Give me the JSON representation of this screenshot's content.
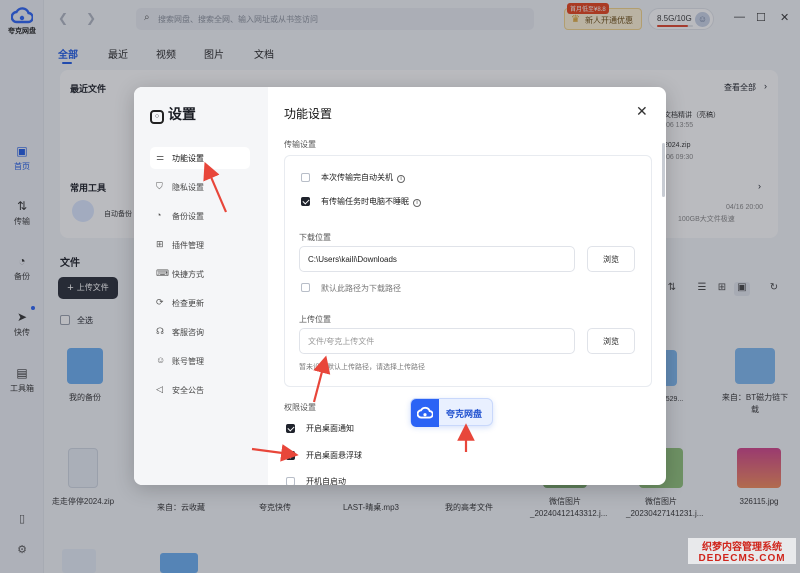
{
  "app": {
    "logo_label": "夸克网盘",
    "brand_color": "#2b63f5"
  },
  "rail": {
    "items": [
      {
        "label": "首页",
        "icon": "home-icon"
      },
      {
        "label": "传输",
        "icon": "transfer-icon"
      },
      {
        "label": "备份",
        "icon": "backup-icon"
      },
      {
        "label": "快传",
        "icon": "send-icon"
      },
      {
        "label": "工具箱",
        "icon": "toolbox-icon"
      }
    ]
  },
  "topbar": {
    "search_placeholder": "搜索网盘、搜索全网、输入网址或从书签访问",
    "promo_badge": "首月低至¥8.8",
    "promo_text": "新人开通优惠",
    "storage": "8.5G/10G",
    "storage_used_fraction": 0.85
  },
  "tabs": [
    "全部",
    "最近",
    "视频",
    "图片",
    "文档"
  ],
  "background": {
    "recent_title": "最近文件",
    "view_all": "查看全部",
    "common_tools": "常用工具",
    "auto_backup": "自动备份",
    "recent_right_1": "文档精讲（亮稿）",
    "recent_right_1_date": "/06 13:55",
    "recent_right_2": "2024.zip",
    "recent_right_2_date": "/06 09:30",
    "recent_right_3_date": "04/16 20:00",
    "recent_right_3_sub": "100GB大文件极速",
    "files_title": "文件",
    "upload_label": "上传文件",
    "select_all": "全选",
    "tiles": [
      {
        "name": "我的备份"
      },
      {
        "name": "来自：BT磁力链下载"
      },
      {
        "name": "走走停停2024.zip"
      },
      {
        "name": "来自：云收藏"
      },
      {
        "name": "夸克快传"
      },
      {
        "name": "LAST-晴桌.mp3"
      },
      {
        "name": "我的高考文件"
      },
      {
        "name": "微信图片_20240412143312.j..."
      },
      {
        "name": "微信图片_20230427141231.j..."
      },
      {
        "name": "326115.jpg"
      },
      {
        "name": "来-24 4529..."
      }
    ]
  },
  "dialog": {
    "title": "设置",
    "nav": [
      {
        "label": "功能设置",
        "icon": "sliders-icon",
        "active": true
      },
      {
        "label": "隐私设置",
        "icon": "shield-icon",
        "active": false
      },
      {
        "label": "备份设置",
        "icon": "backup-icon",
        "active": false
      },
      {
        "label": "插件管理",
        "icon": "plugin-icon",
        "active": false
      },
      {
        "label": "快捷方式",
        "icon": "shortcut-icon",
        "active": false
      },
      {
        "label": "检查更新",
        "icon": "update-icon",
        "active": false
      },
      {
        "label": "客服咨询",
        "icon": "headset-icon",
        "active": false
      },
      {
        "label": "账号管理",
        "icon": "account-icon",
        "active": false
      },
      {
        "label": "安全公告",
        "icon": "announce-icon",
        "active": false
      }
    ],
    "heading": "功能设置",
    "transfer_section": "传输设置",
    "opt_shutdown": "本次传输完自动关机",
    "opt_no_sleep": "有传输任务时电脑不睡眠",
    "download_label": "下载位置",
    "download_path": "C:\\Users\\kaili\\Downloads",
    "browse": "浏览",
    "download_default": "默认此路径为下载路径",
    "upload_label": "上传位置",
    "upload_placeholder": "文件/夸克上传文件",
    "upload_hint": "暂未设置默认上传路径，请选择上传路径",
    "permission_section": "权限设置",
    "opt_desktop_notify": "开启桌面通知",
    "opt_floating_ball": "开启桌面悬浮球",
    "opt_autostart": "开机自启动"
  },
  "floating_ball": {
    "label": "夸克网盘"
  },
  "watermark": {
    "line1": "织梦内容管理系统",
    "line2": "DEDECMS.COM"
  }
}
